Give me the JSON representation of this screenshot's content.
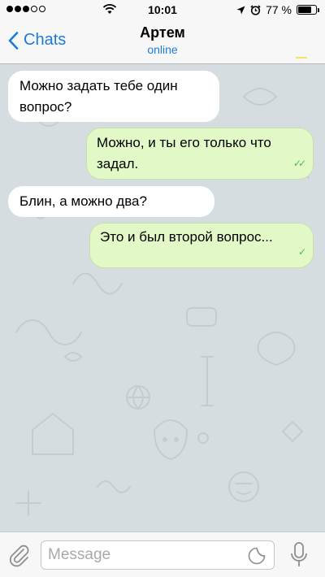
{
  "status_bar": {
    "time": "10:01",
    "battery_text": "77 %",
    "battery_level": 0.77,
    "signal_dots_filled": 3,
    "signal_dots_total": 5
  },
  "nav": {
    "back_label": "Chats",
    "contact_name": "Артем",
    "contact_status": "online"
  },
  "messages": [
    {
      "direction": "in",
      "line1": "Можно задать тебе один",
      "line2": "вопрос?"
    },
    {
      "direction": "out",
      "line1": "Можно, и ты его только что",
      "line2": "задал.",
      "status": "read"
    },
    {
      "direction": "in",
      "line1": "Блин, а можно два?"
    },
    {
      "direction": "out",
      "line1": "Это и был второй вопрос...",
      "status": "sent"
    }
  ],
  "input": {
    "placeholder": "Message"
  },
  "colors": {
    "accent": "#1d7bd8",
    "outgoing_bubble": "#e2f8c6",
    "incoming_bubble": "#ffffff",
    "chat_background": "#d6dde0",
    "check": "#4cbb5a"
  },
  "icons": [
    "signal-dots-icon",
    "wifi-icon",
    "location-arrow-icon",
    "alarm-clock-icon",
    "battery-icon",
    "chevron-left-icon",
    "paperclip-icon",
    "sticker-icon",
    "microphone-icon"
  ]
}
